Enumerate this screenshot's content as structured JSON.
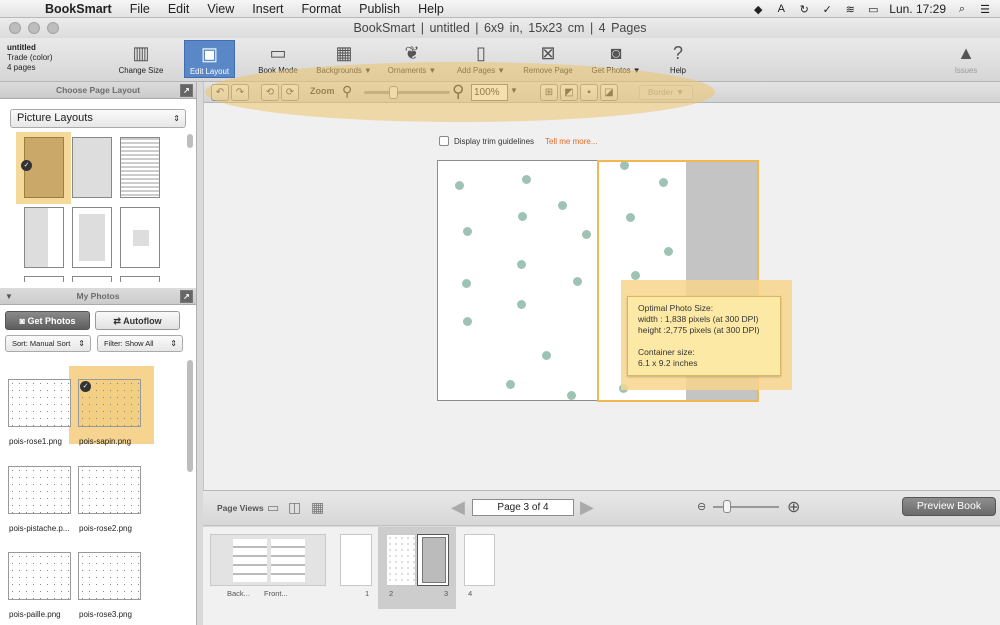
{
  "menubar": {
    "app": "BookSmart",
    "items": [
      "File",
      "Edit",
      "View",
      "Insert",
      "Format",
      "Publish",
      "Help"
    ],
    "clock": "Lun. 17:29"
  },
  "window": {
    "title": "BookSmart  |  untitled  |  6x9 in, 15x23 cm  |  4 Pages"
  },
  "book_info": {
    "name": "untitled",
    "format": "Trade (color)",
    "pages": "4 pages"
  },
  "toolbar": {
    "change_size": "Change Size",
    "edit_layout": "Edit Layout",
    "book_mode": "Book Mode",
    "backgrounds": "Backgrounds ▼",
    "ornaments": "Ornaments ▼",
    "add_pages": "Add Pages ▼",
    "remove_page": "Remove Page",
    "get_photos": "Get Photos ▼",
    "help": "Help",
    "issues": "Issues",
    "issues_badge": "!"
  },
  "editbar": {
    "zoom_label": "Zoom",
    "zoom_value": "100%",
    "border": "Border ▼"
  },
  "layout_panel": {
    "title": "Choose Page Layout",
    "category": "Picture Layouts"
  },
  "photos_panel": {
    "title": "My Photos",
    "get_photos": "Get Photos",
    "autoflow": "Autoflow",
    "sort": "Sort:  Manual Sort",
    "filter": "Filter: Show All",
    "photos": [
      "pois-rose1.png",
      "pois-sapin.png",
      "pois-pistache.p...",
      "pois-rose2.png",
      "pois-paille.png",
      "pois-rose3.png"
    ]
  },
  "canvas": {
    "trim_label": "Display trim guidelines",
    "tell_me": "Tell me more...",
    "tooltip": {
      "line1": "Optimal Photo Size:",
      "line2": "width : 1,838 pixels (at 300 DPI)",
      "line3": "height :2,775 pixels (at 300 DPI)",
      "line4": "Container size:",
      "line5": "6.1 x 9.2 inches"
    }
  },
  "pageviews": {
    "label": "Page Views",
    "indicator": "Page 3 of 4",
    "preview": "Preview Book"
  },
  "strip": {
    "labels": [
      "Back...",
      "Front...",
      "1",
      "2",
      "3",
      "4"
    ]
  },
  "colors": {
    "accent": "#5a88c7",
    "highlight": "#f0b84e",
    "dot": "#9ec3b4",
    "link": "#e06b2a"
  }
}
